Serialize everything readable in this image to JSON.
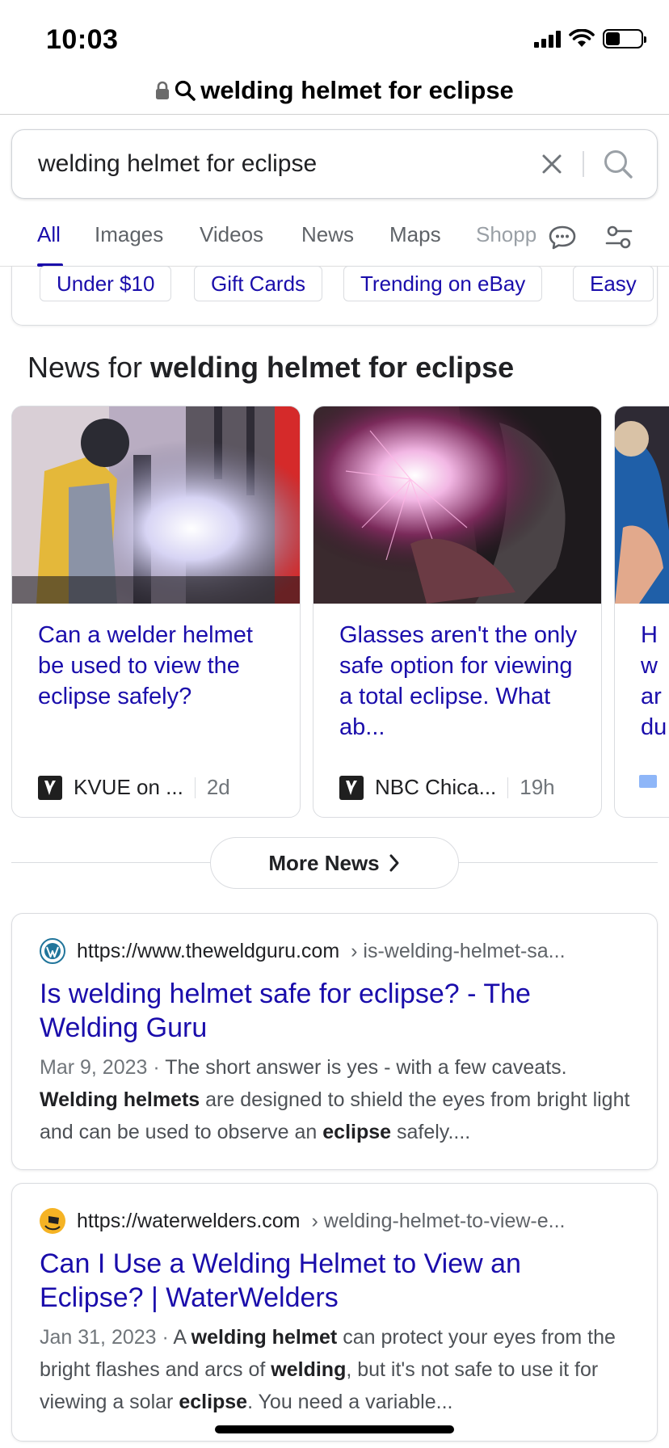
{
  "status_bar": {
    "time": "10:03"
  },
  "address_bar": {
    "query": "welding helmet for eclipse"
  },
  "search": {
    "value": "welding helmet for eclipse",
    "placeholder": ""
  },
  "tabs": [
    {
      "label": "All",
      "active": true
    },
    {
      "label": "Images"
    },
    {
      "label": "Videos"
    },
    {
      "label": "News"
    },
    {
      "label": "Maps"
    },
    {
      "label": "Shopp"
    }
  ],
  "chips": [
    "Under $10",
    "Gift Cards",
    "Trending on eBay",
    "Easy"
  ],
  "news_section": {
    "prefix": "News for ",
    "query": "welding helmet for eclipse",
    "cards": [
      {
        "title": "Can a welder helmet be used to view the eclipse safely?",
        "source": "KVUE on ...",
        "time": "2d"
      },
      {
        "title": "Glasses aren't the only safe option for viewing a total eclipse. What ab...",
        "source": "NBC Chica...",
        "time": "19h"
      },
      {
        "title": "H\nw\nar\ndu",
        "source": "",
        "time": ""
      }
    ],
    "more_label": "More News"
  },
  "results": [
    {
      "domain": "https://www.theweldguru.com",
      "path": "› is-welding-helmet-sa...",
      "title": "Is welding helmet safe for eclipse? - The Welding Guru",
      "date": "Mar 9, 2023",
      "snippet_parts": [
        {
          "t": "The short answer is yes - with a few caveats. "
        },
        {
          "t": "Welding helmets",
          "b": true
        },
        {
          "t": " are designed to shield the eyes from bright light and can be used to observe an "
        },
        {
          "t": "eclipse",
          "b": true
        },
        {
          "t": " safely...."
        }
      ]
    },
    {
      "domain": "https://waterwelders.com",
      "path": "› welding-helmet-to-view-e...",
      "title": "Can I Use a Welding Helmet to View an Eclipse? | WaterWelders",
      "date": "Jan 31, 2023",
      "snippet_parts": [
        {
          "t": "A "
        },
        {
          "t": "welding helmet",
          "b": true
        },
        {
          "t": " can protect your eyes from the bright flashes and arcs of "
        },
        {
          "t": "welding",
          "b": true
        },
        {
          "t": ", but it's not safe to use it for viewing a solar "
        },
        {
          "t": "eclipse",
          "b": true
        },
        {
          "t": ". You need a variable..."
        }
      ]
    }
  ],
  "colors": {
    "link": "#1a0dab",
    "border": "#dadce0",
    "muted": "#70757a"
  }
}
